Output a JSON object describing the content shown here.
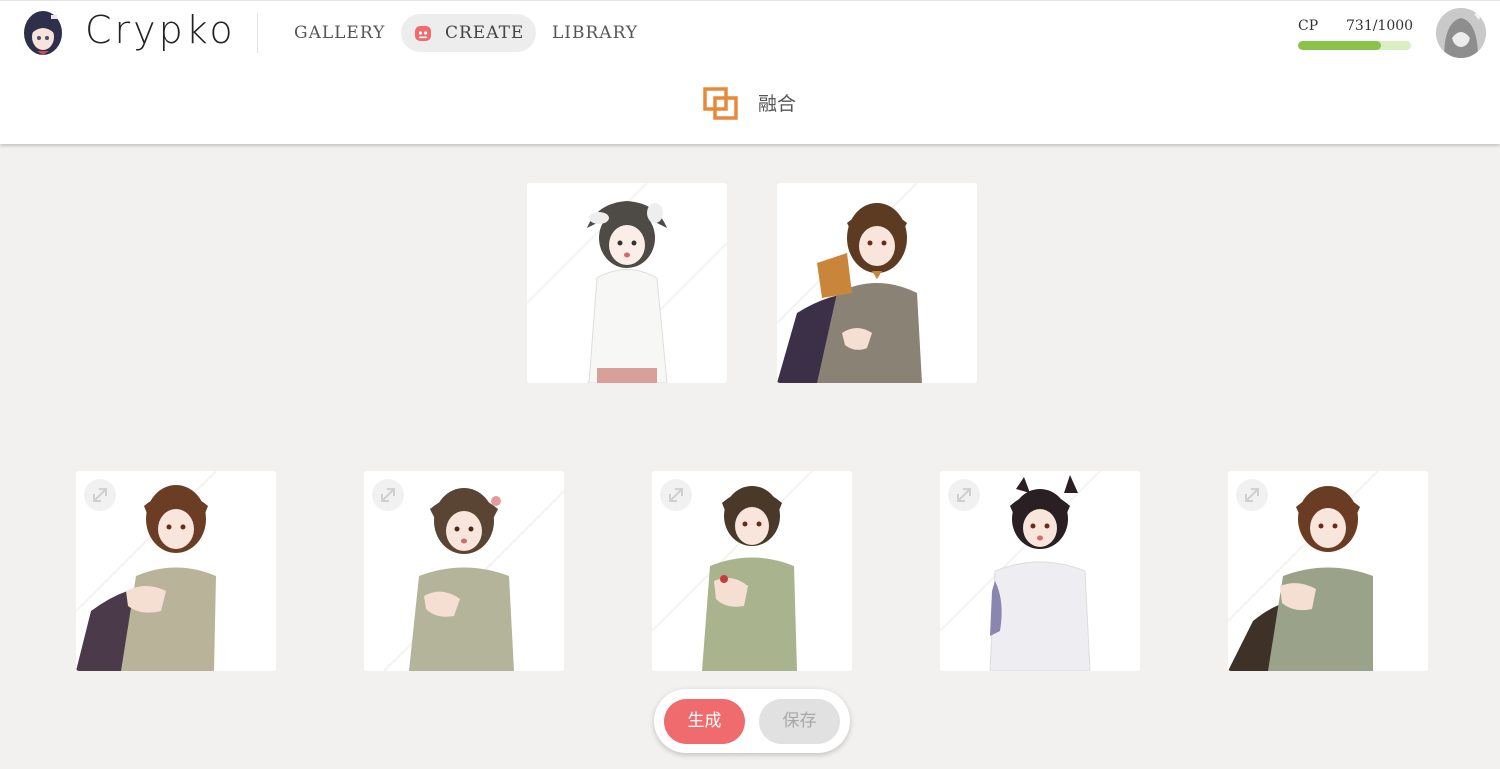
{
  "app": {
    "name": "Crypko"
  },
  "nav": {
    "gallery": "GALLERY",
    "create": "CREATE",
    "library": "LIBRARY"
  },
  "cp": {
    "label": "CP",
    "value": "731/1000",
    "fraction": 0.731
  },
  "page": {
    "title": "融合"
  },
  "parents": [
    {
      "name": "parent-1",
      "hair": "#4e4a45"
    },
    {
      "name": "parent-2",
      "hair": "#5d3a22"
    }
  ],
  "results": [
    {
      "name": "result-1",
      "hair": "#6b3d25"
    },
    {
      "name": "result-2",
      "hair": "#5a4535"
    },
    {
      "name": "result-3",
      "hair": "#4a3828"
    },
    {
      "name": "result-4",
      "hair": "#2a2024"
    },
    {
      "name": "result-5",
      "hair": "#6a3c24"
    }
  ],
  "actions": {
    "generate": "生成",
    "save": "保存"
  },
  "colors": {
    "accent": "#ef6b6d",
    "cp_bar": "#8bc34a",
    "fusion_icon": "#e8893a"
  },
  "icons": [
    "crypko-logo-avatar",
    "create-face-icon",
    "user-avatar",
    "fusion-icon",
    "expand-icon"
  ]
}
